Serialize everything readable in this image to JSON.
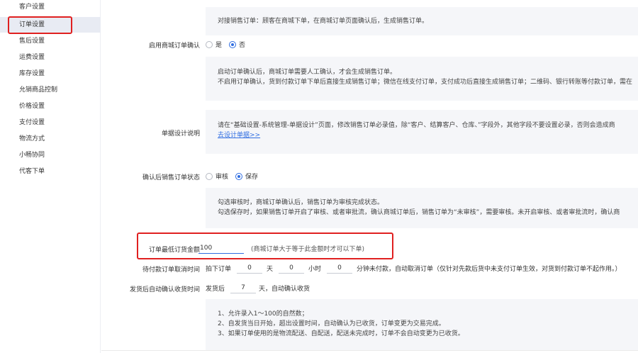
{
  "sidebar": {
    "items": [
      {
        "label": "客户设置",
        "active": false
      },
      {
        "label": "订单设置",
        "active": true
      },
      {
        "label": "售后设置",
        "active": false
      },
      {
        "label": "运费设置",
        "active": false
      },
      {
        "label": "库存设置",
        "active": false
      },
      {
        "label": "允销商品控制",
        "active": false
      },
      {
        "label": "价格设置",
        "active": false
      },
      {
        "label": "支付设置",
        "active": false
      },
      {
        "label": "物流方式",
        "active": false
      },
      {
        "label": "小畅协同",
        "active": false
      },
      {
        "label": "代客下单",
        "active": false
      }
    ]
  },
  "sections": {
    "intro_desc": "对接销售订单：顾客在商城下单，在商城订单页面确认后，生成销售订单。",
    "enable_confirm": {
      "label": "启用商城订单确认",
      "options": [
        "是",
        "否"
      ],
      "selected": "否"
    },
    "confirm_desc": [
      "启动订单确认后，商城订单需要人工确认，才会生成销售订单。",
      "不启用订单确认，货到付款订单下单后直接生成销售订单；微信在线支付订单，支付成功后直接生成销售订单；二维码、银行转账等付款订单，需在"
    ],
    "design_note": {
      "label": "单据设计说明",
      "text": "请在“基础设置-系统管理-单据设计”页面，修改销售订单必录值，除“客户、结算客户、仓库、”字段外，其他字段不要设置必录，否则会造成商",
      "link": "去设计单据>>"
    },
    "status_after_confirm": {
      "label": "确认后销售订单状态",
      "options": [
        "审核",
        "保存"
      ],
      "selected": "保存"
    },
    "status_desc": [
      "勾选审核时，商城订单确认后，销售订单为审核完成状态。",
      "勾选保存时，如果销售订单开启了审核、或者审批流，确认商城订单后，销售订单为“未审核”，需要审核。未开启审核、或者审批流时，确认商"
    ],
    "min_amount": {
      "label": "订单最低订货金额",
      "value": "100",
      "hint": "(商城订单大于等于此金额时才可以下单)"
    },
    "cancel_time": {
      "label": "待付款订单取消时间",
      "prefix": "拍下订单",
      "days": "0",
      "days_unit": "天",
      "hours": "0",
      "hours_unit": "小时",
      "minutes": "0",
      "suffix": "分钟未付款，自动取消订单（仅针对先款后货中未支付订单生效，对货到付款订单不起作用。）"
    },
    "auto_receive": {
      "label": "发货后自动确认收货时间",
      "prefix": "发货后",
      "days": "7",
      "suffix": "天，自动确认收货"
    },
    "rules_desc": [
      "1、允许录入1～100的自然数；",
      "2、自发货当日开始，超出设置时间，自动确认为已收货，订单变更为交易完成。",
      "3、如果订单使用的是物流配送、自配送，配送未完成时，订单不会自动变更为已收货。"
    ]
  },
  "colors": {
    "accent": "#2f6de1",
    "highlight": "#e02020",
    "panel_bg": "#f5f6f9",
    "active_bg": "#e8ebf3"
  }
}
